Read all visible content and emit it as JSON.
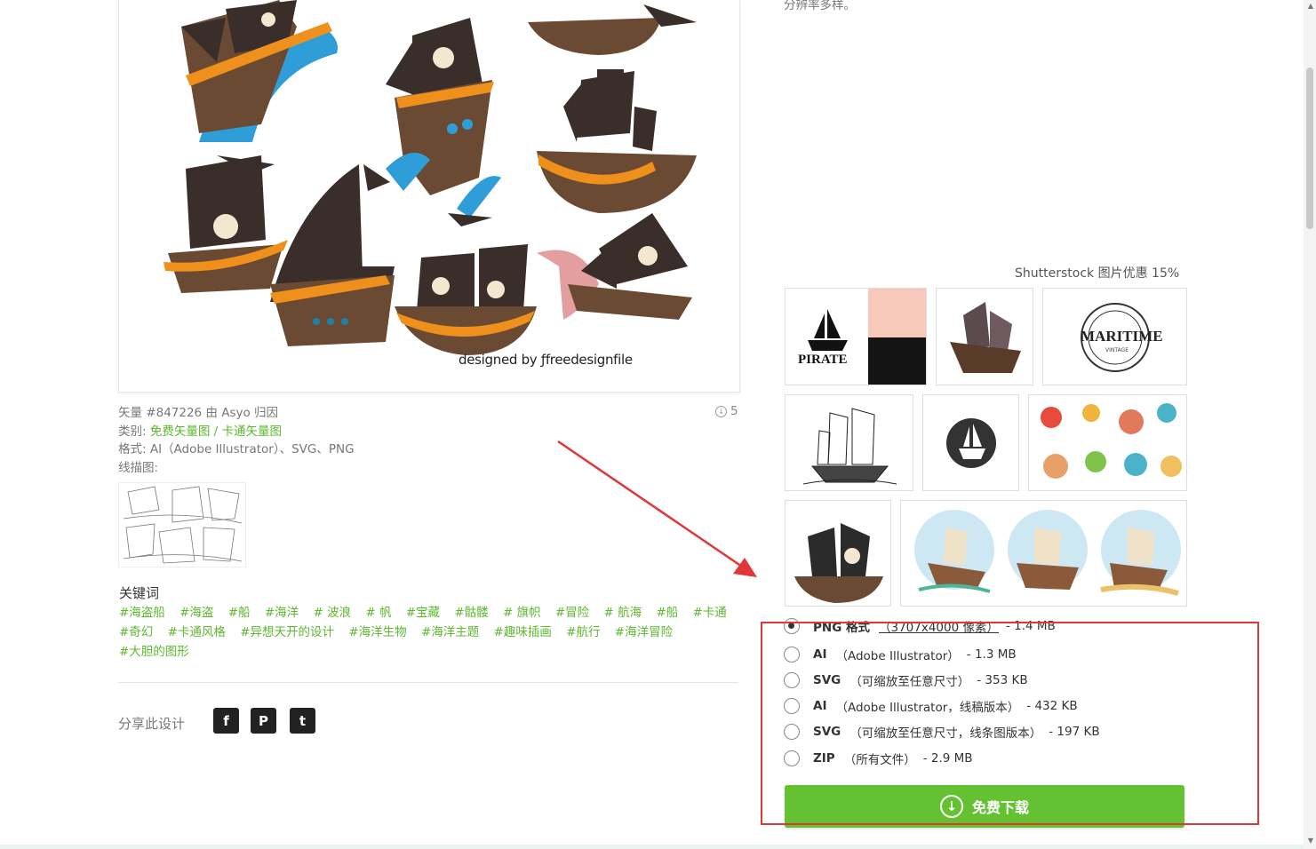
{
  "preview": {
    "credit": "designed by ƒfreedesignfile"
  },
  "meta": {
    "vector_line": "矢量 #847226 由 Asyo 归因",
    "category_label": "类别:",
    "category_links": [
      "免费矢量图",
      "卡通矢量图"
    ],
    "category_sep": " / ",
    "format_line": "格式: AI（Adobe Illustrator）、SVG、PNG",
    "lineart_label": "线描图:",
    "downloads": "5"
  },
  "keywords": {
    "title": "关键词",
    "items": [
      "#海盗船",
      "#海盗",
      "#船",
      "#海洋",
      "# 波浪",
      "# 帆",
      "#宝藏",
      "#骷髅",
      "# 旗帜",
      "#冒险",
      "# 航海",
      "#船",
      "#卡通",
      "#奇幻",
      "#卡通风格",
      "#异想天开的设计",
      "#海洋生物",
      "#海洋主题",
      "#趣味插画",
      "#航行",
      "#海洋冒险",
      "#大胆的图形"
    ]
  },
  "share": {
    "label": "分享此设计",
    "facebook": "f",
    "pinterest": "P",
    "twitter": "t"
  },
  "right": {
    "resolution_note": "分辨率多样。",
    "shutterstock": "Shutterstock 图片优惠 15%",
    "thumb_text": {
      "pirate": "PIRATE",
      "maritime": "MARITIME",
      "vintage": "VINTAGE"
    }
  },
  "formats": [
    {
      "name": "PNG 格式",
      "detail": "（3707x4000 像素）",
      "size": "- 1.4 MB",
      "checked": true
    },
    {
      "name": "AI",
      "detail": "（Adobe Illustrator）",
      "size": "- 1.3 MB",
      "checked": false
    },
    {
      "name": "SVG",
      "detail": "（可缩放至任意尺寸）",
      "size": "- 353 KB",
      "checked": false
    },
    {
      "name": "AI",
      "detail": "（Adobe Illustrator，线稿版本）",
      "size": "- 432 KB",
      "checked": false
    },
    {
      "name": "SVG",
      "detail": "（可缩放至任意尺寸，线条图版本）",
      "size": "- 197 KB",
      "checked": false
    },
    {
      "name": "ZIP",
      "detail": "（所有文件）",
      "size": "- 2.9 MB",
      "checked": false
    }
  ],
  "download_button": "免费下载",
  "colors": {
    "green": "#63c132",
    "link_green": "#5cb82e",
    "annotation_red": "#e03838",
    "hull_brown": "#6b4a33",
    "sail_dark": "#3a2e2b",
    "trim_orange": "#f0901c",
    "wave_blue": "#2f9ed8"
  }
}
